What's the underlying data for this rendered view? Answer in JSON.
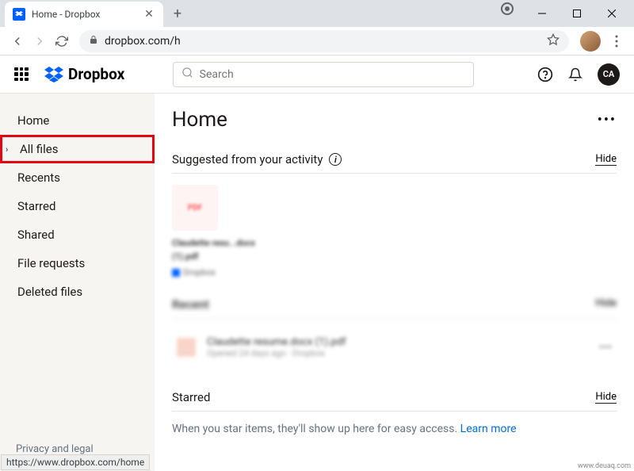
{
  "browser": {
    "tab_title": "Home - Dropbox",
    "url": "dropbox.com/h",
    "status_url": "https://www.dropbox.com/home"
  },
  "header": {
    "brand": "Dropbox",
    "search_placeholder": "Search",
    "avatar_initials": "CA"
  },
  "sidebar": {
    "items": [
      {
        "label": "Home"
      },
      {
        "label": "All files"
      },
      {
        "label": "Recents"
      },
      {
        "label": "Starred"
      },
      {
        "label": "Shared"
      },
      {
        "label": "File requests"
      },
      {
        "label": "Deleted files"
      }
    ],
    "footer": "Privacy and legal"
  },
  "main": {
    "title": "Home",
    "suggested": {
      "title": "Suggested from your activity",
      "hide": "Hide",
      "file_badge": "PDF",
      "file_name": "Claudette resu...docx (1).pdf",
      "file_source": "Dropbox"
    },
    "recent": {
      "title": "Recent",
      "hide": "Hide",
      "item_name": "Claudette resume.docx (1).pdf",
      "item_sub": "Opened 24 days ago · Dropbox"
    },
    "starred": {
      "title": "Starred",
      "hide": "Hide",
      "empty": "When you star items, they'll show up here for easy access. ",
      "learn": "Learn more"
    }
  },
  "citation": "www.deuaq.com"
}
